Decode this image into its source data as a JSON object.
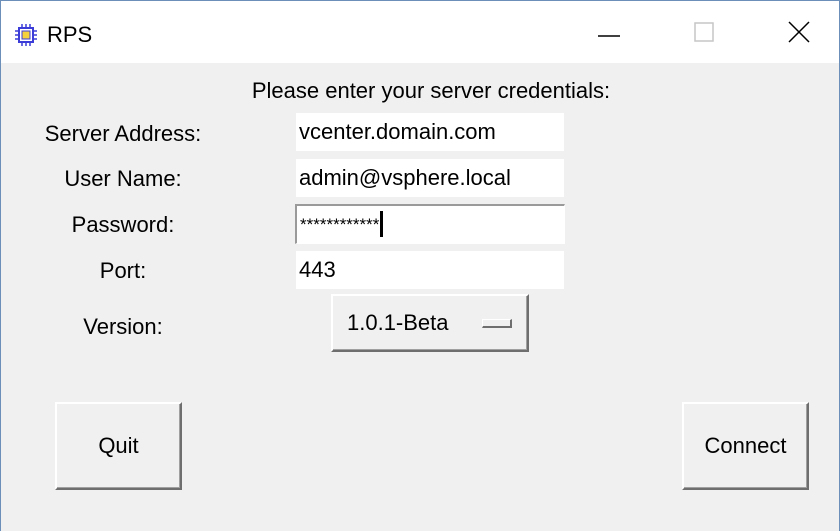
{
  "window": {
    "title": "RPS",
    "icon": "chip-icon",
    "accent_color": "#3c3cd8"
  },
  "form": {
    "prompt": "Please enter your server credentials:",
    "server_label": "Server Address:",
    "server_value": "vcenter.domain.com",
    "user_label": "User Name:",
    "user_value": "admin@vsphere.local",
    "password_label": "Password:",
    "password_value": "************",
    "port_label": "Port:",
    "port_value": "443",
    "version_label": "Version:",
    "version_value": "1.0.1-Beta"
  },
  "buttons": {
    "quit": "Quit",
    "connect": "Connect"
  }
}
